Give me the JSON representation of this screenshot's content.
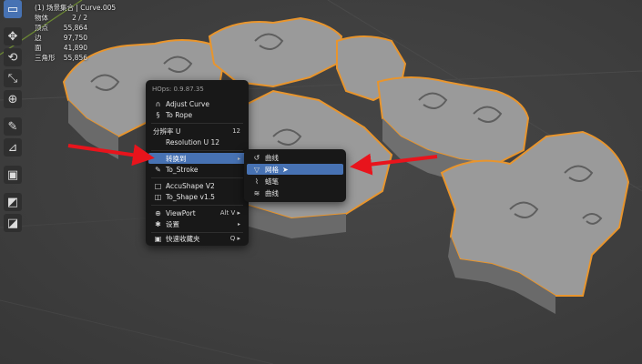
{
  "stats": {
    "title": "(1) 场景集合 | Curve.005",
    "rows": [
      {
        "label": "物体",
        "value": "2 / 2"
      },
      {
        "label": "顶点",
        "value": "55,864"
      },
      {
        "label": "边",
        "value": "97,750"
      },
      {
        "label": "面",
        "value": "41,890"
      },
      {
        "label": "三角形",
        "value": "55,856"
      }
    ]
  },
  "toolbar": {
    "tools": [
      {
        "name": "select-tool",
        "icon": "▭"
      },
      {
        "name": "move-tool",
        "icon": "✥"
      },
      {
        "name": "rotate-tool",
        "icon": "⟲"
      },
      {
        "name": "scale-tool",
        "icon": "⤡"
      },
      {
        "name": "transform-tool",
        "icon": "⊕"
      },
      {
        "name": "annotate-tool",
        "icon": "✎"
      },
      {
        "name": "measure-tool",
        "icon": "📐"
      },
      {
        "name": "add-cube-tool",
        "icon": "▣"
      },
      {
        "name": "bevel-tool",
        "icon": "◩"
      },
      {
        "name": "shape-tool",
        "icon": "◪"
      }
    ]
  },
  "hops_menu": {
    "header": "HOps: 0.9.87.35",
    "adjust_curve": "Adjust Curve",
    "to_rope": "To Rope",
    "resolution_label": "分辨率 U",
    "resolution_value": "12",
    "resolution_u": "Resolution U 12",
    "convert_to": "转换到",
    "to_stroke": "To_Stroke",
    "accushape": "AccuShape V2",
    "to_shape": "To_Shape v1.5",
    "viewport": "ViewPort",
    "viewport_shortcut": "Alt V",
    "settings": "设置",
    "quick_fav": "快速收藏夹",
    "quick_fav_shortcut": "Q"
  },
  "sub_menu": {
    "items": [
      {
        "label": "曲线",
        "icon": "curve-icon"
      },
      {
        "label": "网格",
        "icon": "mesh-icon"
      },
      {
        "label": "蜡笔",
        "icon": "grease-pencil-icon"
      },
      {
        "label": "曲线",
        "icon": "curves-hair-icon"
      }
    ]
  },
  "colors": {
    "accent": "#4772b3",
    "menu_bg": "#181818",
    "outline": "#e8952d",
    "arrow": "#e8141c"
  }
}
